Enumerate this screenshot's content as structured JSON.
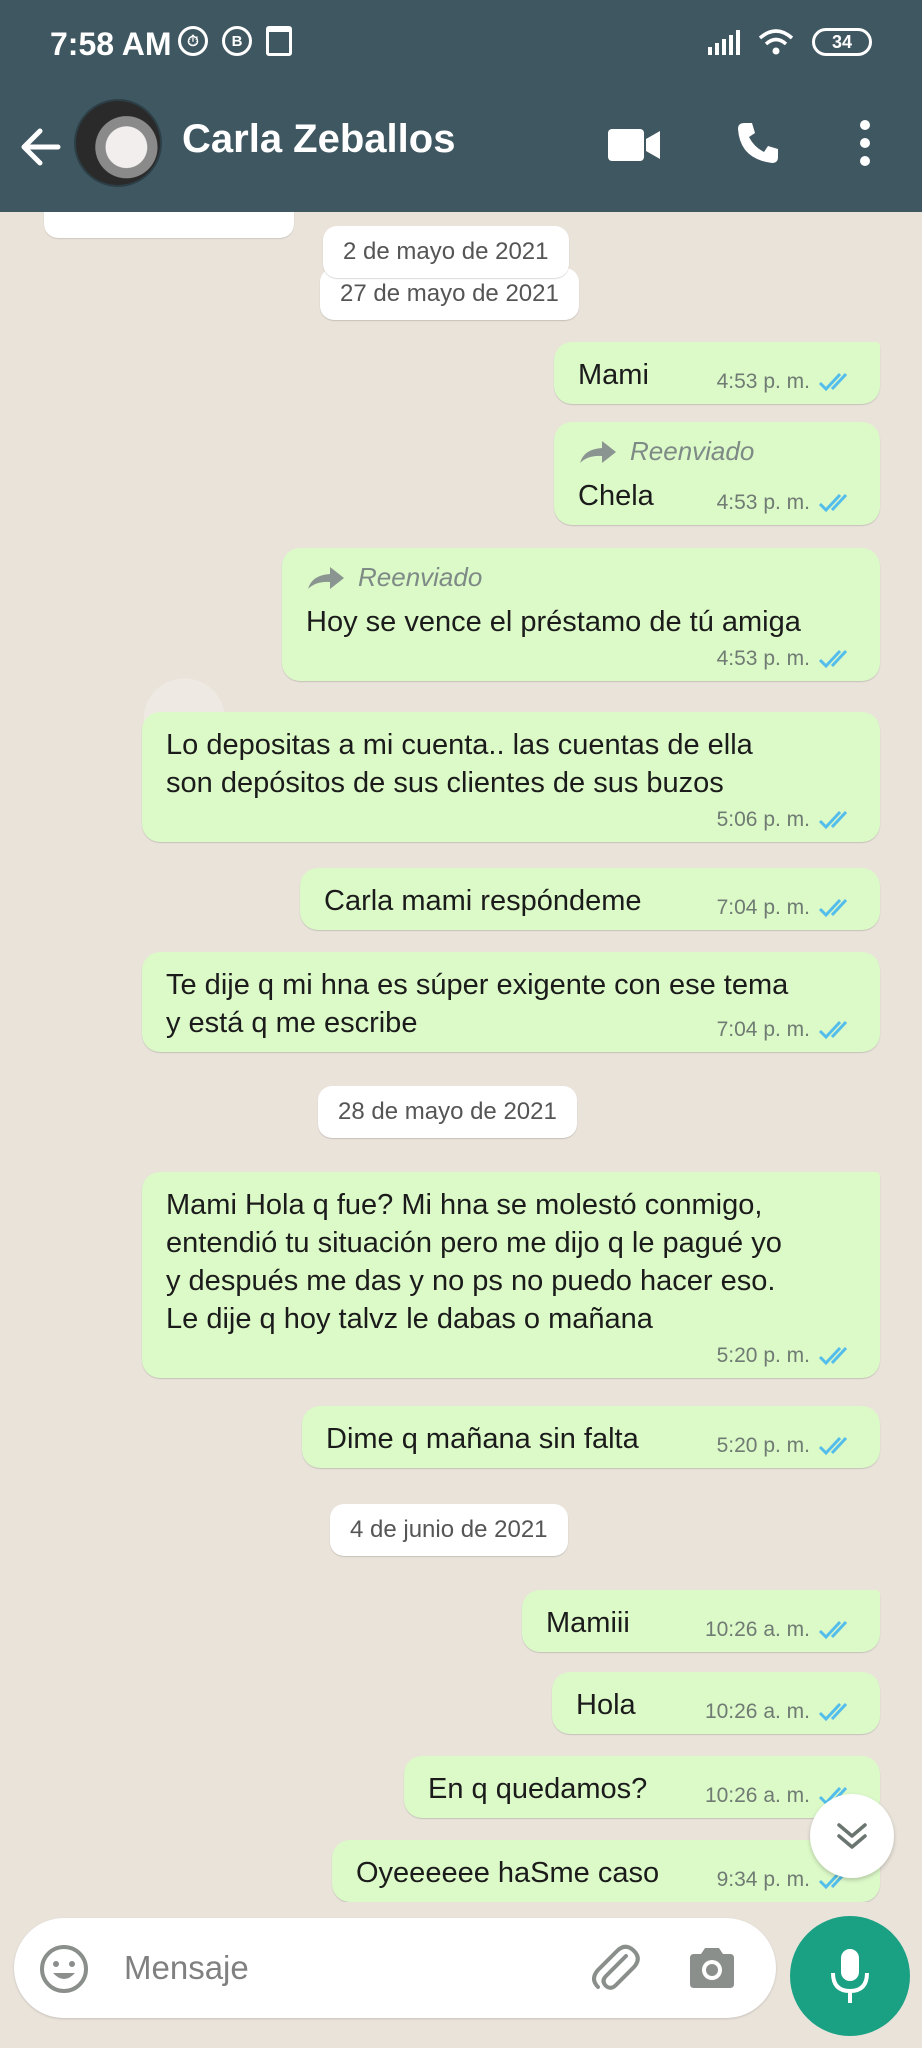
{
  "status_bar": {
    "time": "7:58 AM",
    "left_icons": [
      "alarm-icon",
      "b-icon",
      "trash-icon"
    ],
    "right_icons": [
      "signal-icon",
      "wifi-icon"
    ],
    "battery": "34"
  },
  "header": {
    "contact_name": "Carla Zeballos",
    "icons": [
      "back-arrow-icon",
      "avatar",
      "video-call-icon",
      "phone-icon",
      "menu-icon"
    ]
  },
  "colors": {
    "header_bg": "#3f5761",
    "outgoing_bubble": "#dcf9c8",
    "read_ticks": "#53bdeb",
    "accent_mic": "#1aa184",
    "chat_bg": "#e9e3da"
  },
  "chat": {
    "date_overlay": "2 de mayo de 2021",
    "dates": [
      "27 de mayo de 2021",
      "28 de mayo de 2021",
      "4 de junio de 2021"
    ],
    "forwarded_label": "Reenviado",
    "messages": [
      {
        "text": "Mami",
        "time": "4:53 p. m."
      },
      {
        "text": "Chela",
        "time": "4:53 p. m.",
        "forwarded": true
      },
      {
        "text": "Hoy se vence el préstamo de tú amiga",
        "time": "4:53 p. m.",
        "forwarded": true
      },
      {
        "line1": "Lo depositas a mi cuenta.. las cuentas de ella",
        "line2": "son depósitos de sus clientes de sus buzos",
        "time": "5:06 p. m."
      },
      {
        "text": "Carla mami respóndeme",
        "time": "7:04 p. m."
      },
      {
        "line1": "Te dije q mi hna es súper exigente con ese tema",
        "line2": "y está q me escribe",
        "time": "7:04 p. m."
      },
      {
        "line1": "Mami Hola q fue? Mi hna se molestó conmigo,",
        "line2": "entendió tu situación pero me dijo q le pagué yo",
        "line3": "y después me das y no ps no puedo hacer eso.",
        "line4": "Le dije q hoy talvz le dabas o mañana",
        "time": "5:20 p. m."
      },
      {
        "text": "Dime q mañana sin falta",
        "time": "5:20 p. m."
      },
      {
        "text": "Mamiii",
        "time": "10:26 a. m."
      },
      {
        "text": "Hola",
        "time": "10:26 a. m."
      },
      {
        "text": "En q quedamos?",
        "time": "10:26 a. m."
      },
      {
        "text": "Oyeeeeee haSme caso",
        "time": "9:34 p. m."
      }
    ]
  },
  "input": {
    "placeholder": "Mensaje",
    "icons": [
      "emoji-icon",
      "attach-icon",
      "camera-icon",
      "mic-icon"
    ]
  }
}
